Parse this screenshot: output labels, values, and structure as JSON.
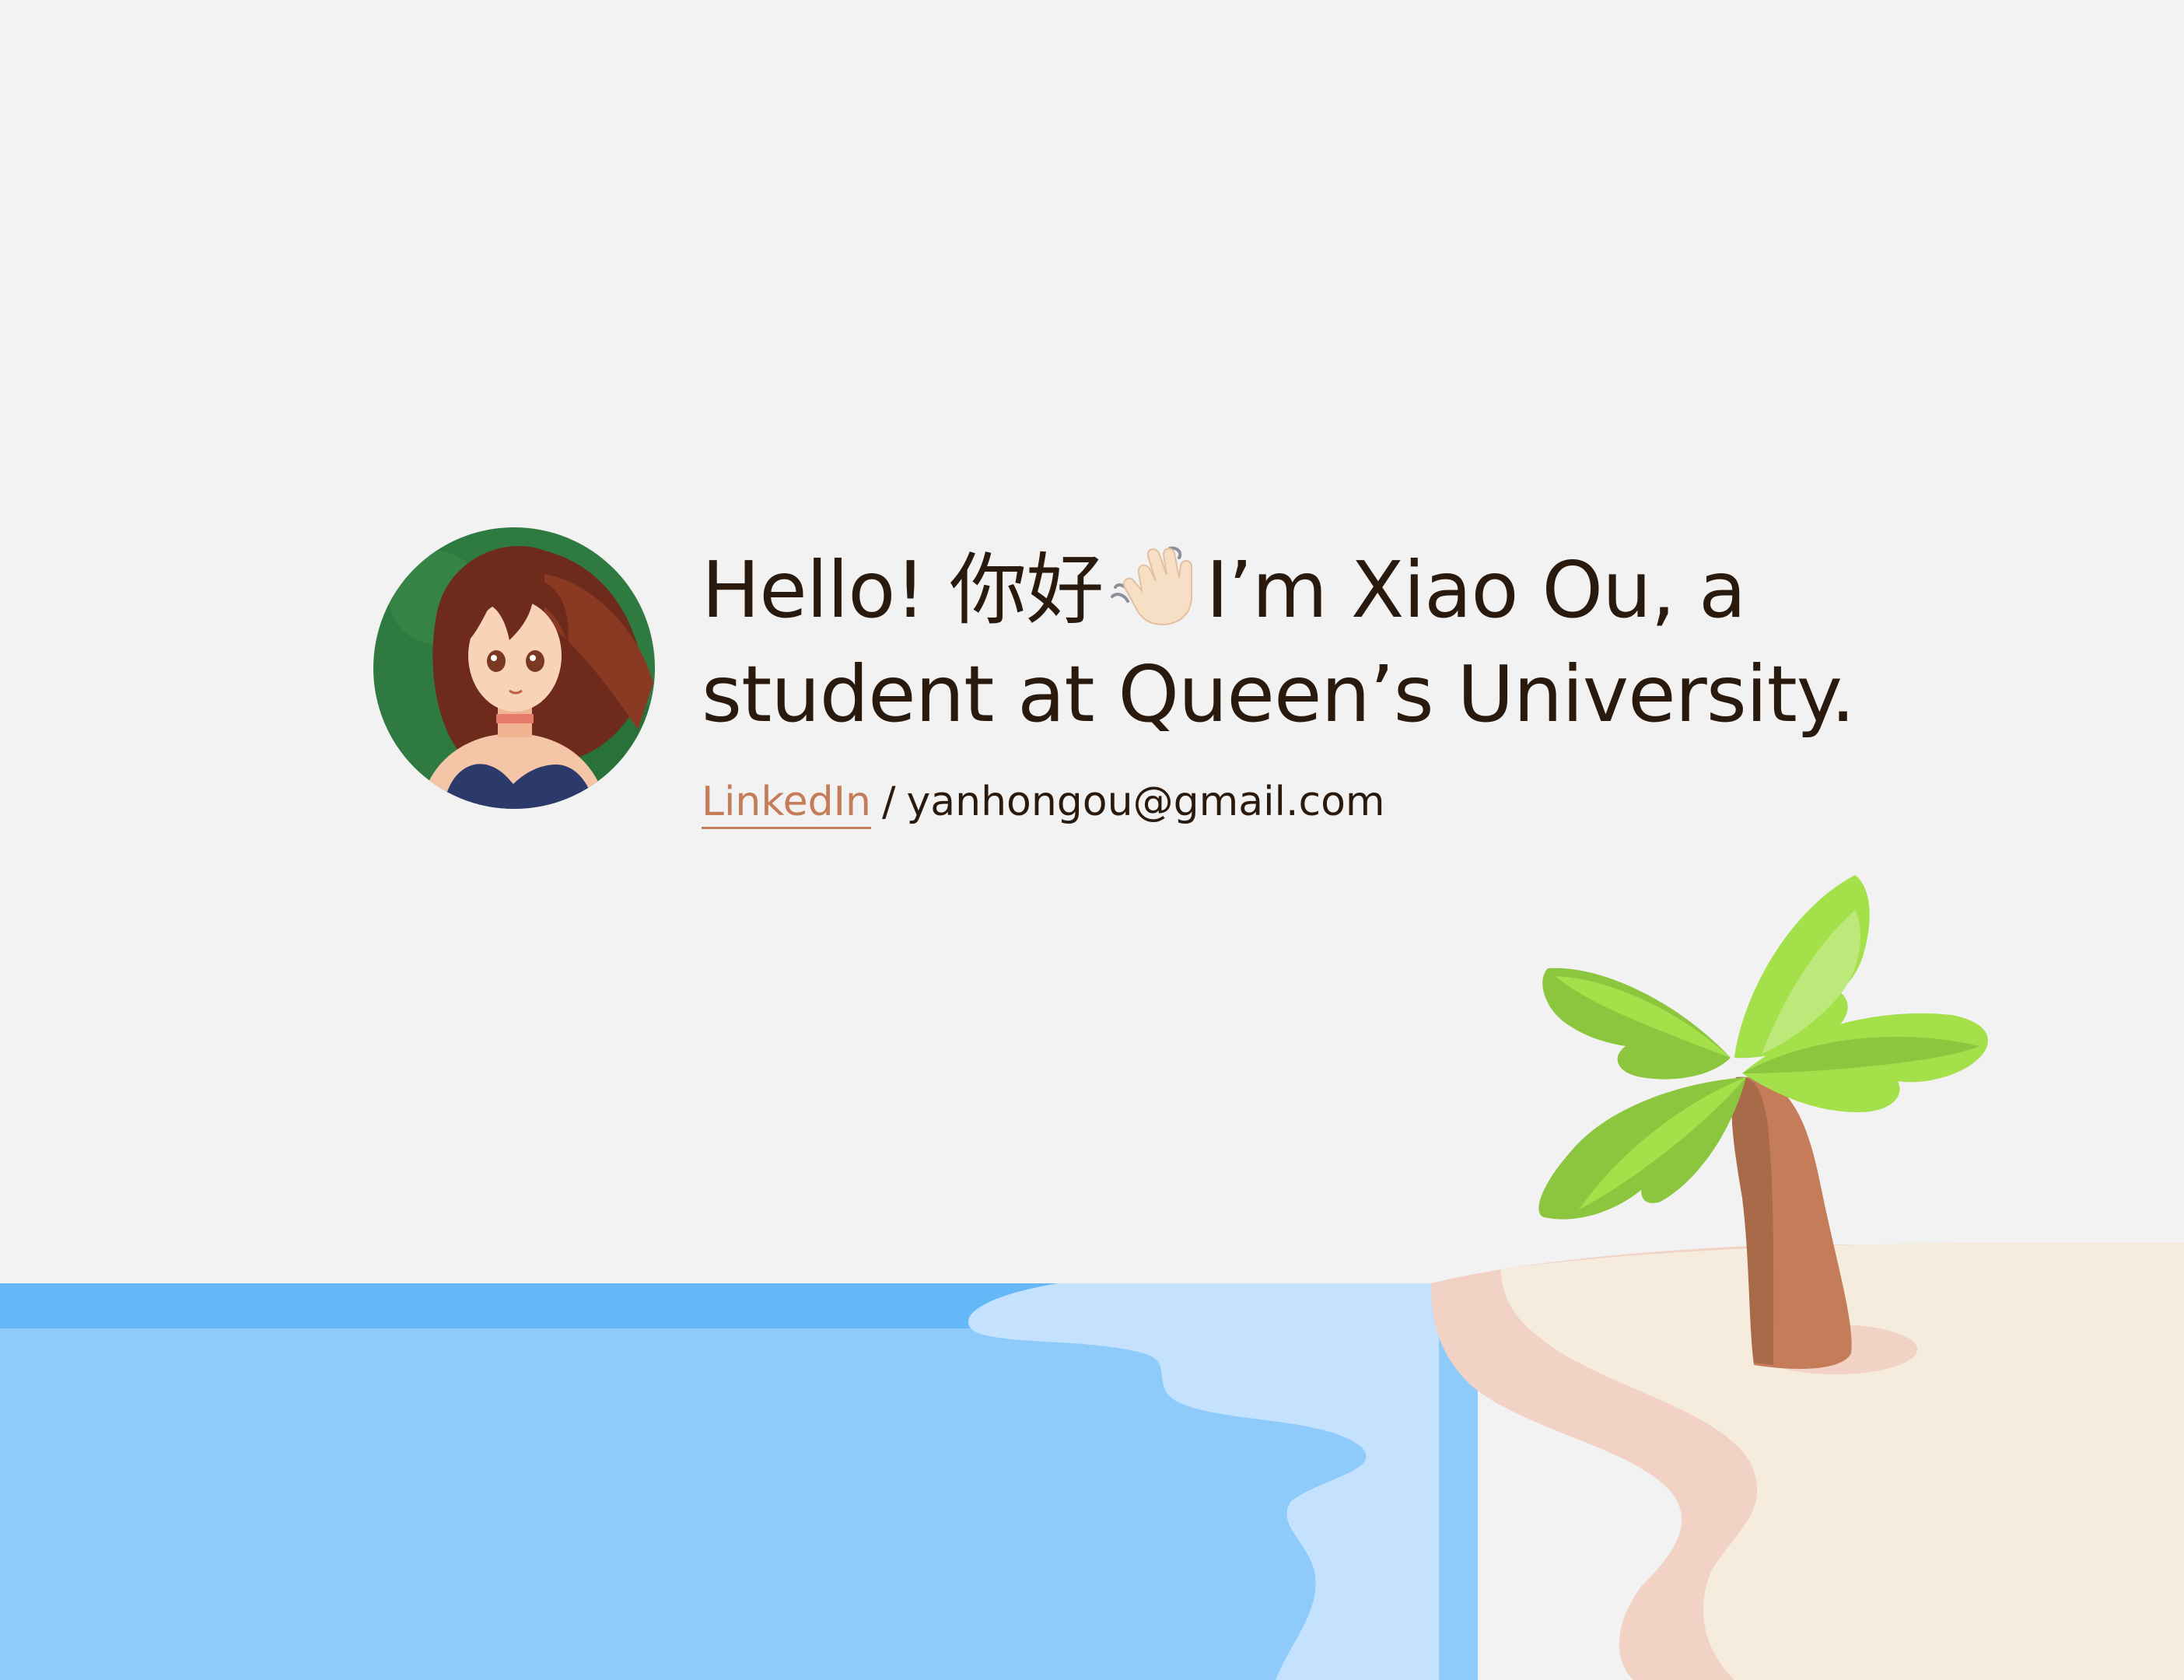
{
  "intro": {
    "greeting_line1_start": "Hello! 你好",
    "greeting_line1_end": "I’m Xiao Ou, a",
    "greeting_line2": "student at Queen’s University.",
    "linkedin_label": "LinkedIn",
    "separator": "/",
    "email": "yanhongou@gmail.com"
  },
  "icons": {
    "wave": "waving-hand-icon",
    "avatar": "anime-girl-avatar",
    "palm": "palm-tree-icon"
  },
  "colors": {
    "background": "#f2f2f2",
    "text": "#2a1a0e",
    "link": "#c47c59",
    "sea_dark": "#64b8f8",
    "sea": "#8ecbfa",
    "surf": "#c4e2fe",
    "wet_sand": "#f1d2c4",
    "sand": "#f5ecdd"
  }
}
